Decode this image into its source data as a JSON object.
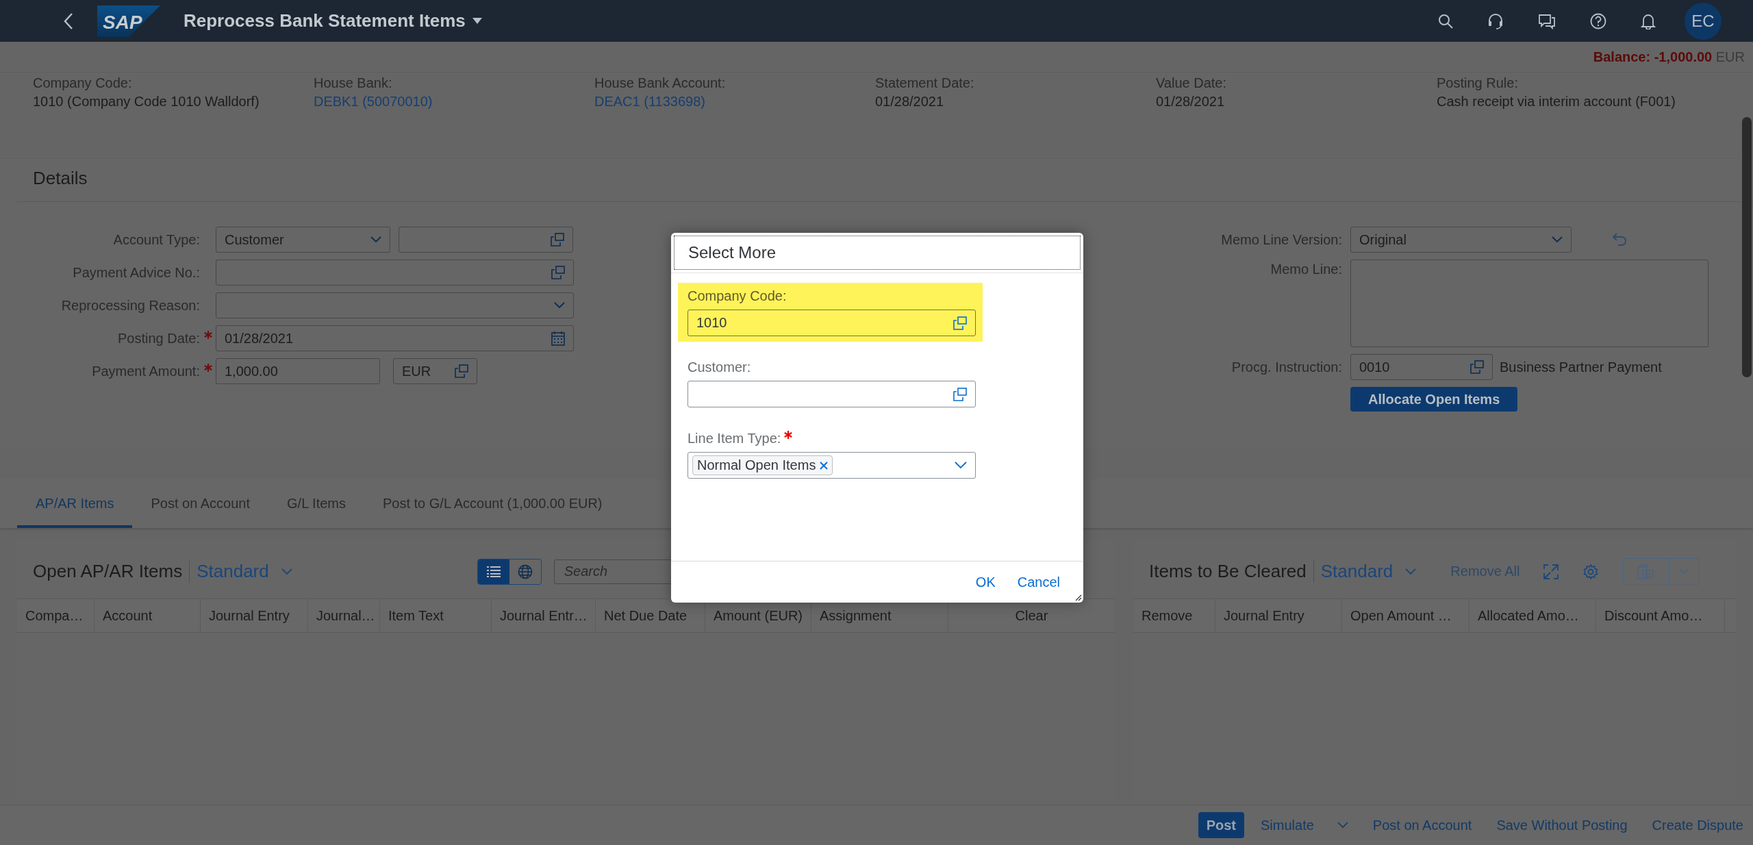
{
  "shell": {
    "logo": "SAP",
    "title": "Reprocess Bank Statement Items",
    "avatar": "EC"
  },
  "balance": {
    "label": "Balance:",
    "amount": "-1,000.00",
    "currency": "EUR"
  },
  "header_attributes": [
    {
      "label": "Company Code:",
      "value": "1010 (Company Code 1010 Walldorf)",
      "kind": "text"
    },
    {
      "label": "House Bank:",
      "value": "DEBK1 (50070010)",
      "kind": "link"
    },
    {
      "label": "House Bank Account:",
      "value": "DEAC1 (1133698)",
      "kind": "link"
    },
    {
      "label": "Statement Date:",
      "value": "01/28/2021",
      "kind": "text"
    },
    {
      "label": "Value Date:",
      "value": "01/28/2021",
      "kind": "text"
    },
    {
      "label": "Posting Rule:",
      "value": "Cash receipt via interim account (F001)",
      "kind": "text"
    }
  ],
  "details": {
    "title": "Details",
    "left_fields": [
      {
        "label": "Account Type:",
        "kind": "select-pair",
        "value": "Customer",
        "required": false
      },
      {
        "label": "Payment Advice No.:",
        "kind": "value-help",
        "required": false
      },
      {
        "label": "Reprocessing Reason:",
        "kind": "select",
        "required": false
      },
      {
        "label": "Posting Date:",
        "kind": "date",
        "value": "01/28/2021",
        "required": true
      },
      {
        "label": "Payment Amount:",
        "kind": "amount",
        "value": "1,000.00",
        "unit": "EUR",
        "required": true
      }
    ],
    "right_fields": [
      {
        "label": "Memo Line Version:",
        "kind": "select-undo",
        "value": "Original"
      },
      {
        "label": "Memo Line:",
        "kind": "textarea"
      },
      {
        "label": "Procg. Instruction:",
        "kind": "value-help-note",
        "value": "0010",
        "note": "Business Partner Payment"
      }
    ],
    "allocate_button": "Allocate Open Items"
  },
  "tabs": [
    {
      "label": "AP/AR Items",
      "selected": true
    },
    {
      "label": "Post on Account",
      "selected": false
    },
    {
      "label": "G/L Items",
      "selected": false
    },
    {
      "label": "Post to G/L Account (1,000.00 EUR)",
      "selected": false
    }
  ],
  "open_items": {
    "title": "Open AP/AR Items",
    "variant": "Standard",
    "search": {
      "placeholder": "Search"
    },
    "columns": [
      "Compa…",
      "Account",
      "Journal Entry",
      "Journal…",
      "Item Text",
      "Journal Entr…",
      "Net Due Date",
      "Amount (EUR)",
      "Assignment",
      "Clear"
    ]
  },
  "cleared_items": {
    "title": "Items to Be Cleared",
    "variant": "Standard",
    "remove_all": {
      "label": "Remove All",
      "disabled": true
    },
    "columns": [
      "Remove",
      "Journal Entry",
      "Open Amount …",
      "Allocated Amo…",
      "Discount Amo…"
    ]
  },
  "footer": {
    "buttons": [
      {
        "label": "Post",
        "kind": "primary"
      },
      {
        "label": "Simulate",
        "kind": "menu"
      },
      {
        "label": "Post on Account",
        "kind": "plain"
      },
      {
        "label": "Save Without Posting",
        "kind": "plain"
      },
      {
        "label": "Create Dispute",
        "kind": "plain"
      }
    ]
  },
  "dialog": {
    "title": "Select More",
    "fields": [
      {
        "label": "Company Code:",
        "kind": "value-help",
        "value": "1010",
        "required": false,
        "highlighted": true
      },
      {
        "label": "Customer:",
        "kind": "value-help",
        "required": false,
        "highlighted": false
      },
      {
        "label": "Line Item Type:",
        "kind": "multi-combo",
        "tokens": [
          "Normal Open Items"
        ],
        "required": true,
        "highlighted": false
      }
    ],
    "buttons": [
      "OK",
      "Cancel"
    ]
  }
}
